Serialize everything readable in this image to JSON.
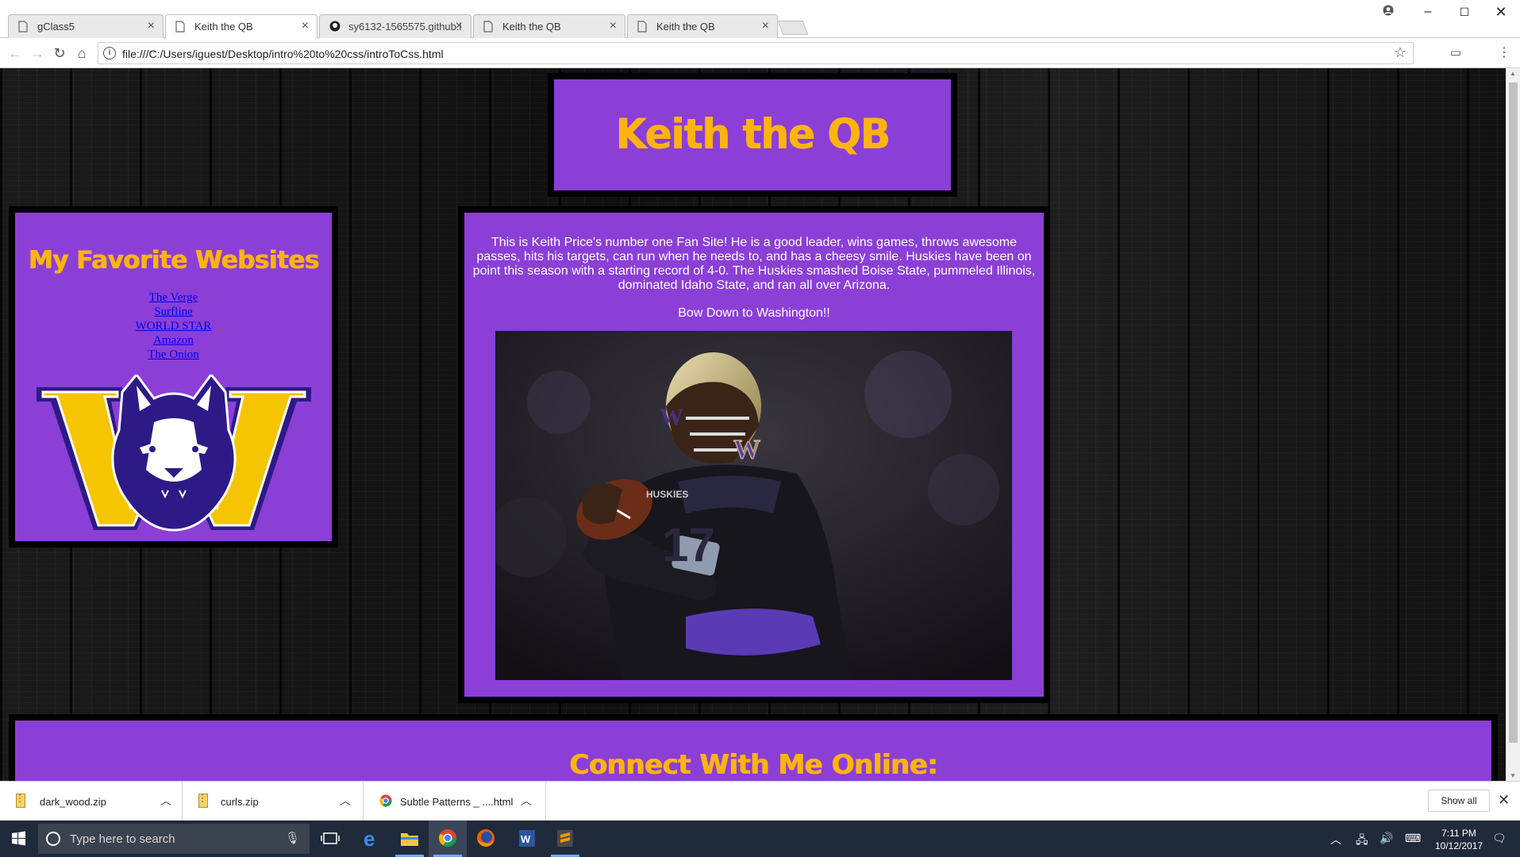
{
  "browser": {
    "tabs": [
      {
        "title": "gClass5",
        "active": false
      },
      {
        "title": "Keith the QB",
        "active": true
      },
      {
        "title": "sy6132-1565575.github.i",
        "active": false
      },
      {
        "title": "Keith the QB",
        "active": false
      },
      {
        "title": "Keith the QB",
        "active": false
      }
    ],
    "url": "file:///C:/Users/iguest/Desktop/intro%20to%20css/introToCss.html"
  },
  "page": {
    "title": "Keith the QB",
    "sidebar": {
      "heading": "My Favorite Websites",
      "links": [
        "The Verge",
        "Surfline",
        "WORLD STAR",
        "Amazon",
        "The Onion"
      ]
    },
    "main": {
      "bio": "This is Keith Price's number one Fan Site! He is a good leader, wins games, throws awesome passes, hits his targets, can run when he needs to, and has a cheesy smile. Huskies have been on point this season with a starting record of 4-0. The Huskies smashed Boise State, pummeled Illinois, dominated Idaho State, and ran all over Arizona.",
      "slogan": "Bow Down to Washington!!"
    },
    "footer": {
      "heading": "Connect With Me Online:"
    },
    "colors": {
      "panel": "#8b3fd6",
      "heading": "#ffb30f",
      "link": "#0000ee"
    }
  },
  "downloads": {
    "items": [
      "dark_wood.zip",
      "curls.zip",
      "Subtle Patterns _ ....html"
    ],
    "show_all": "Show all"
  },
  "taskbar": {
    "search_placeholder": "Type here to search",
    "time": "7:11 PM",
    "date": "10/12/2017"
  }
}
